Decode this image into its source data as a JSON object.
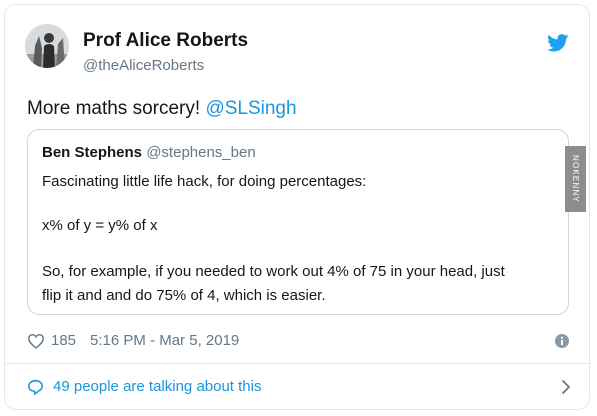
{
  "tweet": {
    "author_name": "Prof Alice Roberts",
    "author_handle": "@theAliceRoberts",
    "text": "More maths sorcery! ",
    "mention": "@SLSingh",
    "likes": "185",
    "timestamp": "5:16 PM - Mar 5, 2019",
    "talking": "49 people are talking about this"
  },
  "quote": {
    "author_name": "Ben Stephens",
    "author_handle": "@stephens_ben",
    "line1": "Fascinating little life hack, for doing percentages:",
    "line2": "x% of y = y% of x",
    "line3": "So, for example, if you needed to work out 4% of 75 in your head, just",
    "line4": "flip it and and do 75% of 4, which is easier."
  },
  "watermark": "NOKENNY",
  "icons": {
    "bird": "twitter-bird-icon",
    "heart": "heart-icon",
    "info": "info-icon",
    "bubble": "speech-bubble-icon",
    "chevron": "chevron-right-icon"
  },
  "colors": {
    "accent": "#1b95e0",
    "text": "#14171a",
    "muted": "#657786",
    "border": "#e1e8ed"
  }
}
